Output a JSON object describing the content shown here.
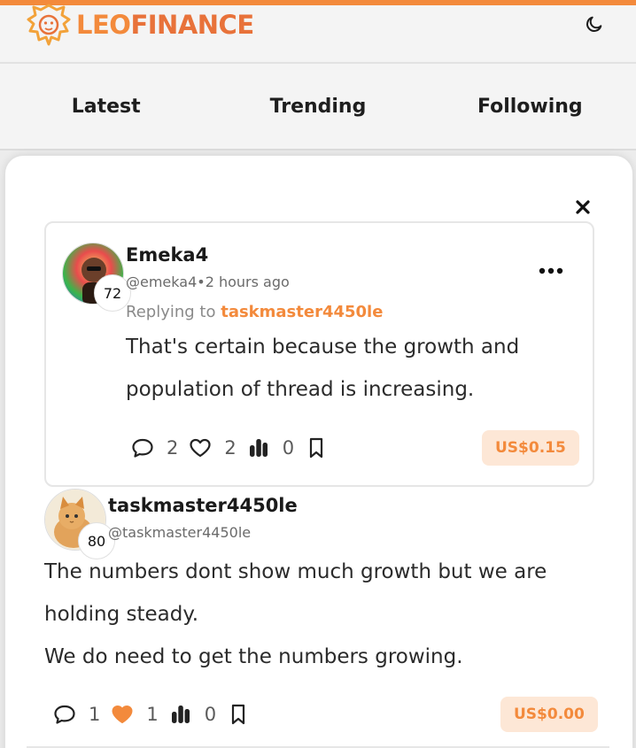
{
  "header": {
    "logo_text_a": "LEO",
    "logo_text_b": "FINANCE",
    "theme_toggle_icon": "moon-icon",
    "accent_color": "#f38a3c"
  },
  "tabs": [
    {
      "label": "Latest"
    },
    {
      "label": "Trending"
    },
    {
      "label": "Following"
    }
  ],
  "thread": {
    "close_icon": "close-icon",
    "parent": {
      "author": "Emeka4",
      "handle": "@emeka4",
      "separator": "•",
      "time_ago": "2 hours ago",
      "reputation": "72",
      "replying_prefix": "Replying to",
      "replying_to": "taskmaster4450le",
      "body": "That's certain because the growth and population of thread is increasing.",
      "comments": "2",
      "likes": "2",
      "votes": "0",
      "liked": false,
      "payout": "US$0.15"
    },
    "reply": {
      "author": "taskmaster4450le",
      "handle": "@taskmaster4450le",
      "reputation": "80",
      "body_lines": [
        "The numbers dont show much growth but we are holding steady.",
        "We do need to get the numbers growing."
      ],
      "comments": "1",
      "likes": "1",
      "votes": "0",
      "liked": true,
      "payout": "US$0.00"
    }
  }
}
